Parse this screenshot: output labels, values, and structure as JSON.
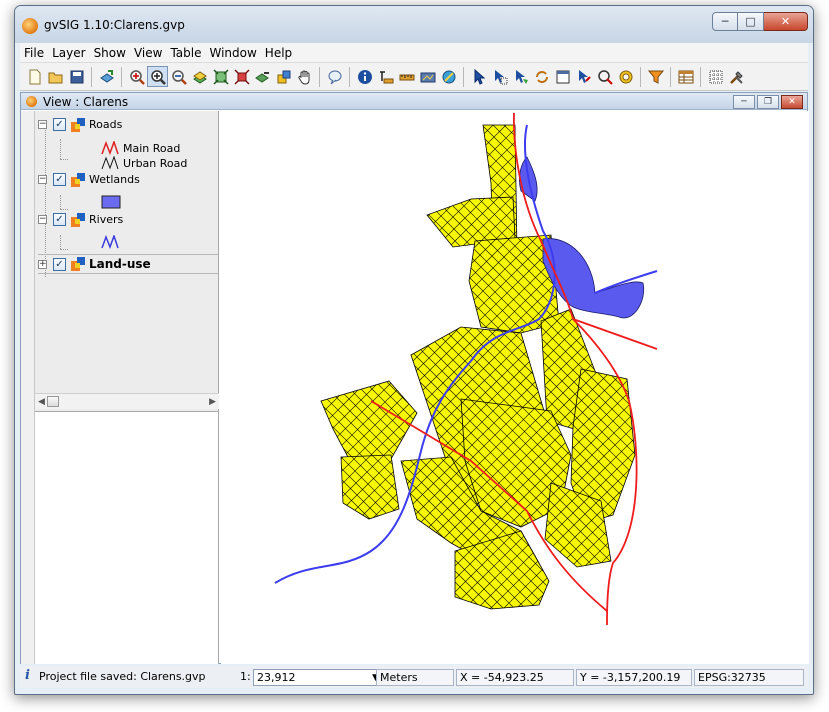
{
  "app": {
    "title": "gvSIG 1.10:Clarens.gvp"
  },
  "menu": [
    "File",
    "Layer",
    "Show",
    "View",
    "Table",
    "Window",
    "Help"
  ],
  "toolbar": {
    "icons": [
      "new-project-icon",
      "open-project-icon",
      "save-project-icon",
      "add-layer-icon",
      "zoom-in-icon",
      "zoom-select-icon",
      "zoom-out-icon",
      "zoom-all-icon",
      "zoom-layer-icon",
      "zoom-extent-icon",
      "zoom-previous-icon",
      "zoom-select-layer-icon",
      "pan-icon",
      "info-bubble-icon",
      "information-icon",
      "measure-distance-icon",
      "measure-area-icon",
      "locator-icon",
      "hyperlink-icon",
      "select-icon",
      "select-rectangle-icon",
      "select-polygon-icon",
      "invert-selection-icon",
      "clear-selection-icon",
      "select-layer-icon",
      "select-circle-icon",
      "select-buffer-icon",
      "filter-icon",
      "table-icon",
      "graticule-icon",
      "tools-icon"
    ],
    "active": "zoom-select-icon"
  },
  "view": {
    "title": "View : Clarens"
  },
  "toc": {
    "layers": [
      {
        "name": "Roads",
        "checked": true,
        "legend": [
          {
            "label": "Main Road",
            "color": "#e02020"
          },
          {
            "label": "Urban Road",
            "color": "#111111"
          }
        ]
      },
      {
        "name": "Wetlands",
        "checked": true,
        "legend": [
          {
            "label": "",
            "color": "#6b6bf0"
          }
        ]
      },
      {
        "name": "Rivers",
        "checked": true,
        "legend": [
          {
            "label": "",
            "color": "#3a3ae0"
          }
        ]
      },
      {
        "name": "Land-use",
        "checked": true,
        "bold": true,
        "legend": []
      }
    ]
  },
  "map": {
    "colors": {
      "landuse_fill": "#f7f700",
      "landuse_stroke": "#000000",
      "main_road": "#ee1c1c",
      "river": "#3c3cf0",
      "wetland": "#5a5aef"
    }
  },
  "status": {
    "message": "Project file saved: Clarens.gvp",
    "scale_prefix": "1:",
    "scale": "23,912",
    "units": "Meters",
    "x": "X = -54,923.25",
    "y": "Y = -3,157,200.19",
    "epsg": "EPSG:32735"
  }
}
